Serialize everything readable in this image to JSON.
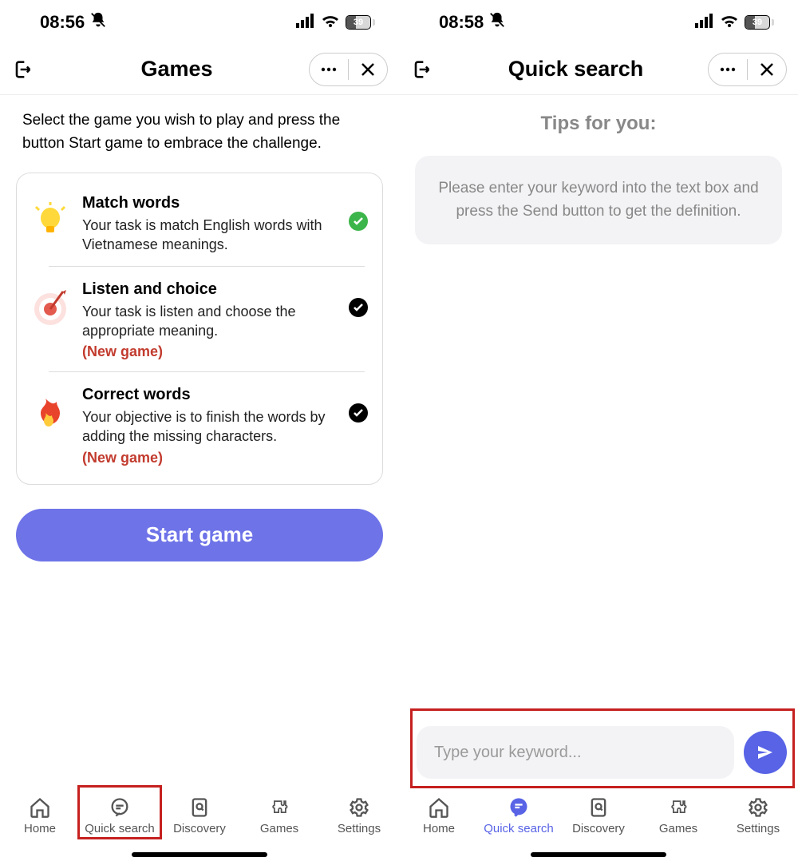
{
  "left": {
    "status": {
      "time": "08:56",
      "battery": "39"
    },
    "header": {
      "title": "Games"
    },
    "instructions": "Select the game you wish to play and press the button Start game to embrace the challenge.",
    "games": [
      {
        "title": "Match words",
        "desc": "Your task is match English words with Vietnamese meanings.",
        "new": "",
        "selected": "green",
        "icon": "bulb"
      },
      {
        "title": "Listen and choice",
        "desc": "Your task is listen and choose the appropriate meaning.",
        "new": "(New game)",
        "selected": "black",
        "icon": "target"
      },
      {
        "title": "Correct words",
        "desc": "Your objective is to finish the words by adding the missing characters.",
        "new": "(New game)",
        "selected": "black",
        "icon": "fire"
      }
    ],
    "start_button": "Start game",
    "nav": {
      "items": [
        {
          "label": "Home",
          "icon": "home"
        },
        {
          "label": "Quick search",
          "icon": "chat"
        },
        {
          "label": "Discovery",
          "icon": "doc"
        },
        {
          "label": "Games",
          "icon": "puzzle"
        },
        {
          "label": "Settings",
          "icon": "gear"
        }
      ],
      "highlighted_index": 1
    }
  },
  "right": {
    "status": {
      "time": "08:58",
      "battery": "39"
    },
    "header": {
      "title": "Quick search"
    },
    "tips_title": "Tips for you:",
    "tips_body": "Please enter your keyword into the text box and press the Send button to get the definition.",
    "input": {
      "placeholder": "Type your keyword..."
    },
    "nav": {
      "items": [
        {
          "label": "Home",
          "icon": "home"
        },
        {
          "label": "Quick search",
          "icon": "chat"
        },
        {
          "label": "Discovery",
          "icon": "doc"
        },
        {
          "label": "Games",
          "icon": "puzzle"
        },
        {
          "label": "Settings",
          "icon": "gear"
        }
      ],
      "active_index": 1
    }
  }
}
